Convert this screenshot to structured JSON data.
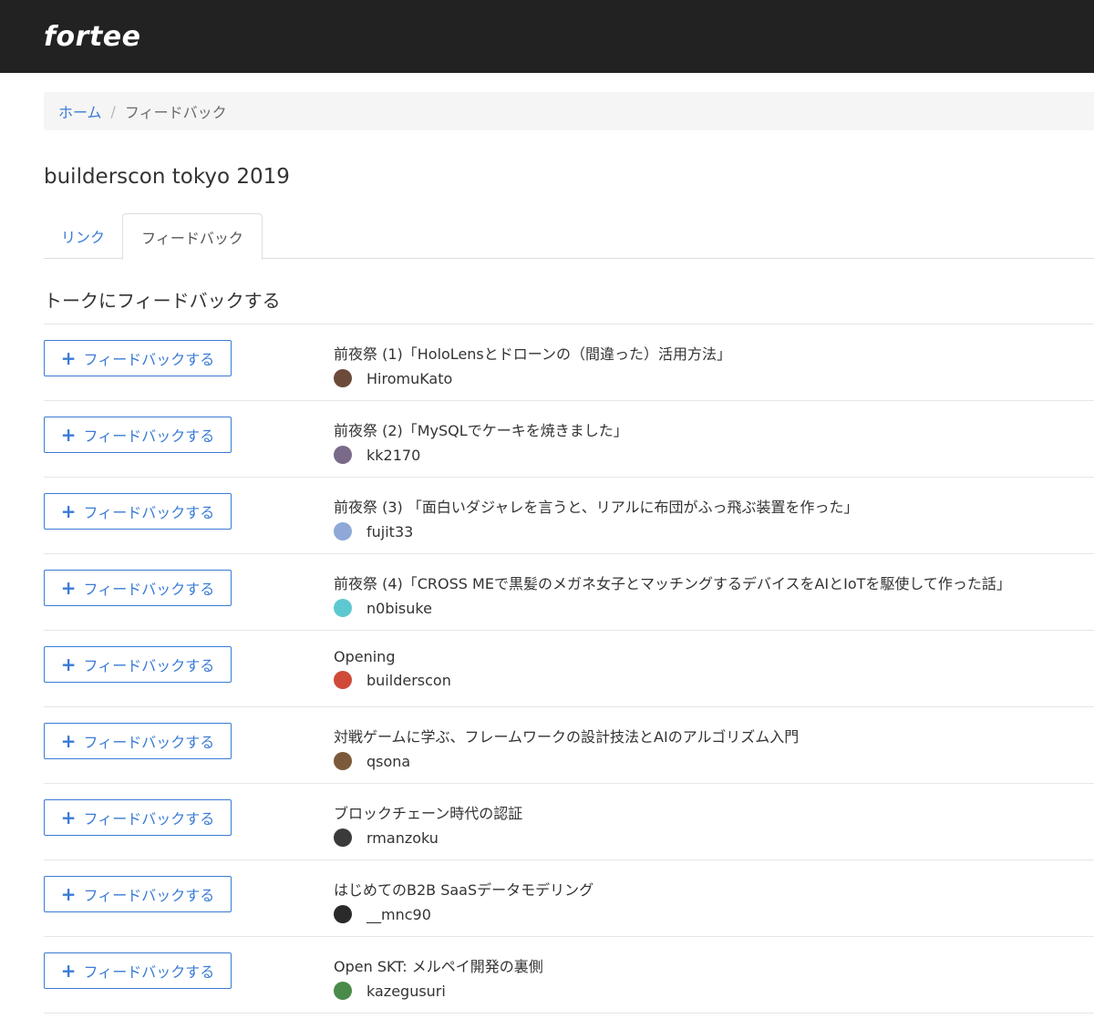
{
  "header": {
    "logo": "fortee"
  },
  "breadcrumb": {
    "home": "ホーム",
    "separator": "/",
    "current": "フィードバック"
  },
  "event": {
    "title": "builderscon tokyo 2019"
  },
  "tabs": [
    {
      "label": "リンク"
    },
    {
      "label": "フィードバック"
    }
  ],
  "section": {
    "title": "トークにフィードバックする"
  },
  "feedback_button": {
    "plus": "+",
    "label": "フィードバックする"
  },
  "talks": [
    {
      "title": "前夜祭 (1)「HoloLensとドローンの（間違った）活用方法」",
      "speaker": "HiromuKato",
      "avatar_color": "#6b4a3a"
    },
    {
      "title": "前夜祭 (2)「MySQLでケーキを焼きました」",
      "speaker": "kk2170",
      "avatar_color": "#7a6a8a"
    },
    {
      "title": "前夜祭 (3) 「面白いダジャレを言うと、リアルに布団がふっ飛ぶ装置を作った」",
      "speaker": "fujit33",
      "avatar_color": "#8fa8d8"
    },
    {
      "title": "前夜祭 (4)「CROSS MEで黒髪のメガネ女子とマッチングするデバイスをAIとIoTを駆使して作った話」",
      "speaker": "n0bisuke",
      "avatar_color": "#5ec8d0"
    },
    {
      "title": "Opening",
      "speaker": "builderscon",
      "avatar_color": "#d04a3a"
    },
    {
      "title": "対戦ゲームに学ぶ、フレームワークの設計技法とAIのアルゴリズム入門",
      "speaker": "qsona",
      "avatar_color": "#7a5a3a"
    },
    {
      "title": "ブロックチェーン時代の認証",
      "speaker": "rmanzoku",
      "avatar_color": "#3a3a3a"
    },
    {
      "title": "はじめてのB2B SaaSデータモデリング",
      "speaker": "__mnc90",
      "avatar_color": "#2a2a2a"
    },
    {
      "title": "Open SKT: メルペイ開発の裏側",
      "speaker": "kazegusuri",
      "avatar_color": "#4a8a4a"
    }
  ]
}
